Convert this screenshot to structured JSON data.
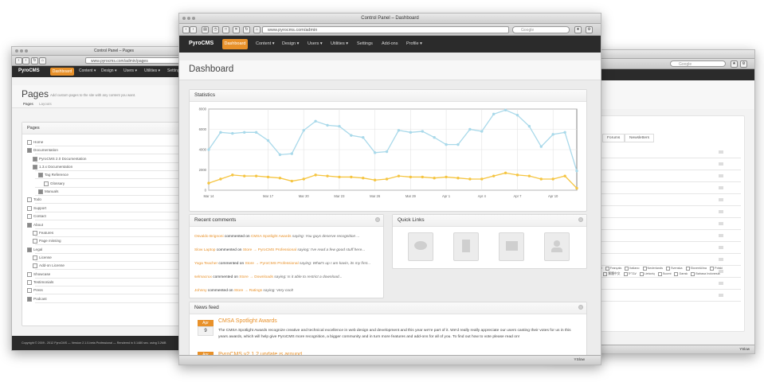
{
  "left_window": {
    "title": "Control Panel – Pages",
    "url": "www.pyrocms.com/admin/pages",
    "brand": "PyroCMS",
    "nav": [
      "Dashboard",
      "Content ▾",
      "Design ▾",
      "Users ▾",
      "Utilities ▾",
      "Settings"
    ],
    "page_title": "Pages",
    "page_subtitle": "Add custom pages to the site with any content you want.",
    "tabs": [
      "Pages",
      "Layouts"
    ],
    "panel_title": "Pages",
    "tree": [
      "Home",
      "Documentation",
      "PyroCMS 2.0 Documentation",
      "1.3.x Documentation",
      "Tag Reference",
      "Glossary",
      "Manuals",
      "Todo",
      "Support",
      "Contact",
      "About",
      "Features",
      "Page missing",
      "Legal",
      "License",
      "Add-on License",
      "Showcase",
      "Testimonials",
      "Press",
      "Podcast"
    ],
    "footer": "Copyright © 2009 - 2012 PyroCMS  —  Version 2.1.0-beta Professional  —  Rendered in 0.1480 sec. using 3.2MB"
  },
  "right_window": {
    "search_placeholder": "Google",
    "tabs": [
      "Forums",
      "Newsletters"
    ],
    "languages": [
      "Español",
      "Français",
      "Italiano",
      "Nederlands",
      "Svenska",
      "Slovenščina",
      "Polski",
      "日本語",
      "繁體中文",
      "עברית",
      "Lietuvių",
      "Suomi",
      "Dansk",
      "Bahasa Indonesia"
    ],
    "status": "YSlow"
  },
  "main_window": {
    "title": "Control Panel – Dashboard",
    "url": "www.pyrocms.com/admin",
    "search_placeholder": "Google",
    "brand": "PyroCMS",
    "nav": [
      {
        "label": "Dashboard",
        "active": true
      },
      {
        "label": "Content ▾"
      },
      {
        "label": "Design ▾"
      },
      {
        "label": "Users ▾"
      },
      {
        "label": "Utilities ▾"
      },
      {
        "label": "Settings"
      },
      {
        "label": "Add-ons"
      },
      {
        "label": "Profile ▾"
      }
    ],
    "page_title": "Dashboard",
    "statistics_title": "Statistics",
    "recent_comments_title": "Recent comments",
    "comments": [
      {
        "author": "Osvaldo Brignoni",
        "mid": " commented on ",
        "target": "CMSA Spotlight Awards",
        "text": " saying: You guys deserve recognition ..."
      },
      {
        "author": "Slow Laptop",
        "mid": " commented on ",
        "target": "Store → PyroCMS Professional",
        "text": " saying: I've read a few good stuff here..."
      },
      {
        "author": "Yoga Teacher",
        "mid": " commented on ",
        "target": "Store → PyroCMS Professional",
        "text": " saying: What's up I am kavin, its my first..."
      },
      {
        "author": "selmacrux",
        "mid": " commented on ",
        "target": "Store → Downloads",
        "text": " saying: Is it able to restrict a download..."
      },
      {
        "author": "Johnny",
        "mid": " commented on ",
        "target": "Store → Ratings",
        "text": " saying: Very cool!"
      }
    ],
    "quick_links_title": "Quick Links",
    "news_title": "News feed",
    "news": [
      {
        "month": "Apr",
        "day": "9",
        "title": "CMSA Spotlight Awards",
        "body": "The CMSA Spotlight Awards recognize creative and technical excellence in web design and development and this year we're part of it. We'd really really appreciate our users casting their votes for us in this years awards, which will help give PyroCMS more recognition, a bigger community and in turn more features and add-ons for all of you. To find out how to vote please read on!"
      },
      {
        "month": "Apr",
        "day": "",
        "title": "PyroCMS v2.1.2 update is around",
        "body": ""
      }
    ],
    "status": "YSlow"
  },
  "chart_data": {
    "type": "line",
    "title": "",
    "categories": [
      "Mar 14",
      "",
      "",
      "",
      "",
      "Mar 17",
      "",
      "",
      "Mar 20",
      "",
      "",
      "Mar 23",
      "",
      "",
      "Mar 26",
      "",
      "",
      "Mar 29",
      "",
      "",
      "Apr 1",
      "",
      "",
      "Apr 4",
      "",
      "",
      "Apr 7",
      "",
      "",
      "Apr 10",
      ""
    ],
    "ylim": [
      0,
      8000
    ],
    "yticks": [
      "0",
      "2000",
      "4000",
      "6000",
      "8000"
    ],
    "series": [
      {
        "name": "",
        "color": "#a9d9ea",
        "values": [
          4000,
          5700,
          5600,
          5700,
          5700,
          4900,
          3500,
          3600,
          5900,
          6800,
          6400,
          6300,
          5400,
          5200,
          3700,
          3800,
          5900,
          5700,
          5800,
          5200,
          4500,
          4500,
          6000,
          5800,
          7500,
          7900,
          7400,
          6300,
          4300,
          5500,
          5700,
          1900
        ]
      },
      {
        "name": "",
        "color": "#f5c542",
        "values": [
          700,
          1100,
          1500,
          1400,
          1400,
          1300,
          1200,
          900,
          1100,
          1500,
          1400,
          1300,
          1300,
          1200,
          1000,
          1100,
          1400,
          1300,
          1300,
          1200,
          1300,
          1200,
          1100,
          1100,
          1400,
          1700,
          1500,
          1400,
          1100,
          1100,
          1400,
          200
        ]
      }
    ],
    "grid": true
  },
  "colors": {
    "accent": "#e8912a",
    "nav_bg": "#2b2b2b",
    "line_blue": "#a9d9ea",
    "line_yellow": "#f5c542"
  }
}
